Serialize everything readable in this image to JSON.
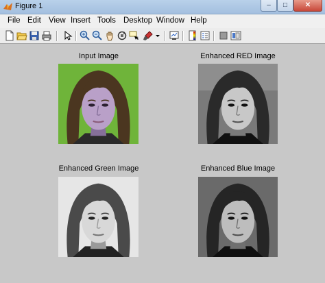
{
  "window": {
    "title": "Figure 1",
    "minimize": "‒",
    "maximize": "□",
    "close": "✕"
  },
  "menu": [
    "File",
    "Edit",
    "View",
    "Insert",
    "Tools",
    "Desktop",
    "Window",
    "Help"
  ],
  "toolbar": {
    "icons": [
      "new-figure-icon",
      "open-file-icon",
      "save-icon",
      "print-icon",
      "edit-plot-arrow-icon",
      "zoom-in-icon",
      "zoom-out-icon",
      "pan-hand-icon",
      "rotate-3d-icon",
      "data-cursor-icon",
      "brush-icon",
      "brush-dropdown-icon",
      "link-plot-icon",
      "insert-colorbar-icon",
      "insert-legend-icon",
      "hide-plot-tools-icon",
      "show-plot-tools-icon"
    ]
  },
  "panels": [
    {
      "title": "Input Image",
      "variant": "color"
    },
    {
      "title": "Enhanced RED Image",
      "variant": "gray-high-contrast"
    },
    {
      "title": "Enhanced Green Image",
      "variant": "gray-light"
    },
    {
      "title": "Enhanced Blue Image",
      "variant": "gray-high-contrast"
    }
  ],
  "colors": {
    "background": "#c8c8c8",
    "input_bg": "#6fb43a"
  }
}
